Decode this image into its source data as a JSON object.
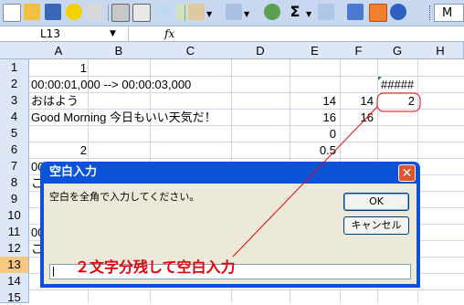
{
  "toolbar": {
    "buttons": [
      "new-icon",
      "open-icon",
      "save-icon",
      "smiley-icon",
      "permission-icon",
      "print-icon",
      "print-preview-icon",
      "spelling-icon",
      "research-icon",
      "cut-icon",
      "paste-icon",
      "undo-icon",
      "hyperlink-icon",
      "autosum-icon",
      "sort-ascending-icon",
      "chart-wizard-icon",
      "drawing-icon",
      "help-icon"
    ],
    "autosum_symbol": "Σ",
    "menu_label": "M"
  },
  "formula_bar": {
    "name_box": "L13",
    "fx_label": "fx",
    "formula": ""
  },
  "sheet": {
    "columns": [
      "A",
      "B",
      "C",
      "D",
      "E",
      "F",
      "G",
      "H"
    ],
    "rows": [
      "1",
      "2",
      "3",
      "4",
      "5",
      "6",
      "7",
      "8",
      "9",
      "10",
      "11",
      "12",
      "13",
      "14",
      "15"
    ],
    "selected_row": "13",
    "cells": {
      "A1": "1",
      "A2": "00:00:01,000 --> 00:00:03,000",
      "G2": "#####",
      "A3": "おはよう",
      "E3": "14",
      "F3": "14",
      "G3": "2",
      "A4": "Good Morning  今日もいい天気だ！",
      "E4": "16",
      "F4": "16",
      "E5": "0",
      "A6": "2",
      "E6": "0.5",
      "A7": "00",
      "A8": "こ",
      "A11": "00",
      "A12": "こ"
    }
  },
  "dialog": {
    "title": "空白入力",
    "prompt": "空白を全角で入力してください。",
    "ok_label": "OK",
    "cancel_label": "キャンセル",
    "input_value": "",
    "close_symbol": "✕"
  },
  "annotation": {
    "text": "２文字分残して空白入力",
    "color": "#e8000a"
  }
}
